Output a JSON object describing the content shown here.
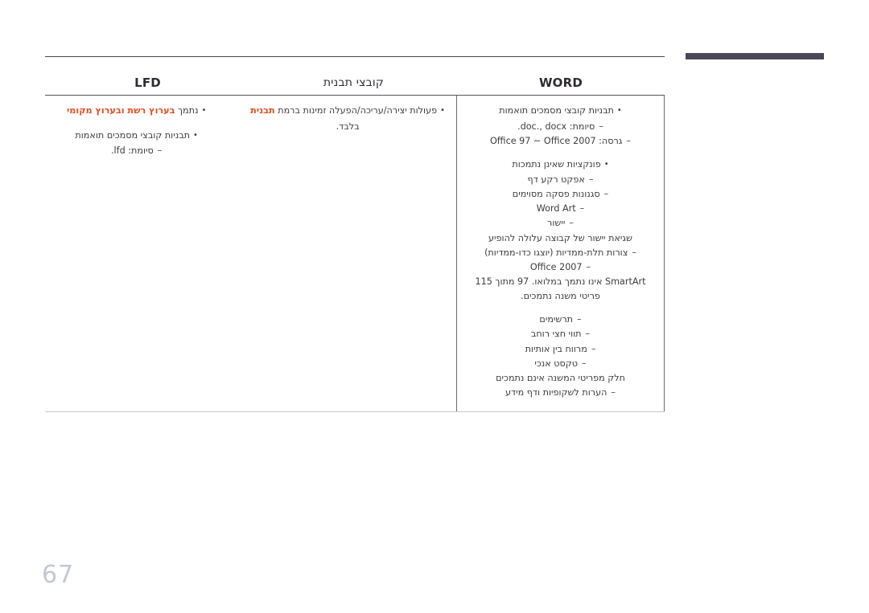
{
  "colors": {
    "accent": "#e04e1f",
    "rule": "#4a4653",
    "top_bar": "#4a4758",
    "page_number": "#c3c7d1",
    "text": "#3d3d3d"
  },
  "header": {
    "col_word": "WORD",
    "col_template": "קובצי תבנית",
    "col_lfd": "LFD"
  },
  "columns": {
    "word": {
      "l1_templates": "תבניות קובצי מסמכים תואמות",
      "l2_extension": "סיומת: doc., docx.",
      "l2_version": "גרסה: Office 97 ~ Office 2007",
      "l1_unsupported": "פונקציות שאינן נתמכות",
      "l2_page_bg": "אפקט רקע דף",
      "l2_para_styles": "סגנונות פסקה מסוימים",
      "l2_wordart": "Word Art",
      "l2_align": "יישור",
      "note_align": "שגיאת יישור של קבוצה עלולה להופיע",
      "l2_3d": "צורות תלת-ממדיות (יוצגו כדו-ממדיות)",
      "l2_office2007": "Office 2007",
      "note_smartart": "SmartArt אינו נתמך במלואו. 97 מתוך 115",
      "note_smartart2": "פריטי משנה נתמכים.",
      "l2_charts": "תרשימים",
      "l2_halfwidth": "תווי חצי רוחב",
      "l2_letterspacing": "מרווח בין אותיות",
      "l2_vertical_text": "טקסט אנכי",
      "note_submenu": "חלק מפריטי המשנה אינם נתמכים",
      "l2_notes": "הערות לשקופיות ודף מידע"
    },
    "template": {
      "l1_actions_pre": "פעולות יצירה/עריכה/הפעלה זמינות ברמת ",
      "l1_actions_hl": "תבנית",
      "l1_actions_post": "בלבד."
    },
    "lfd": {
      "l1_supported_pre": "נתמך ",
      "l1_supported_hl": "בערוץ רשת ובערוץ מקומי",
      "l1_templates": "תבניות קובצי מסמכים תואמות",
      "l2_extension": "סיומת: lfd."
    }
  },
  "footer": {
    "page_number": "67"
  }
}
